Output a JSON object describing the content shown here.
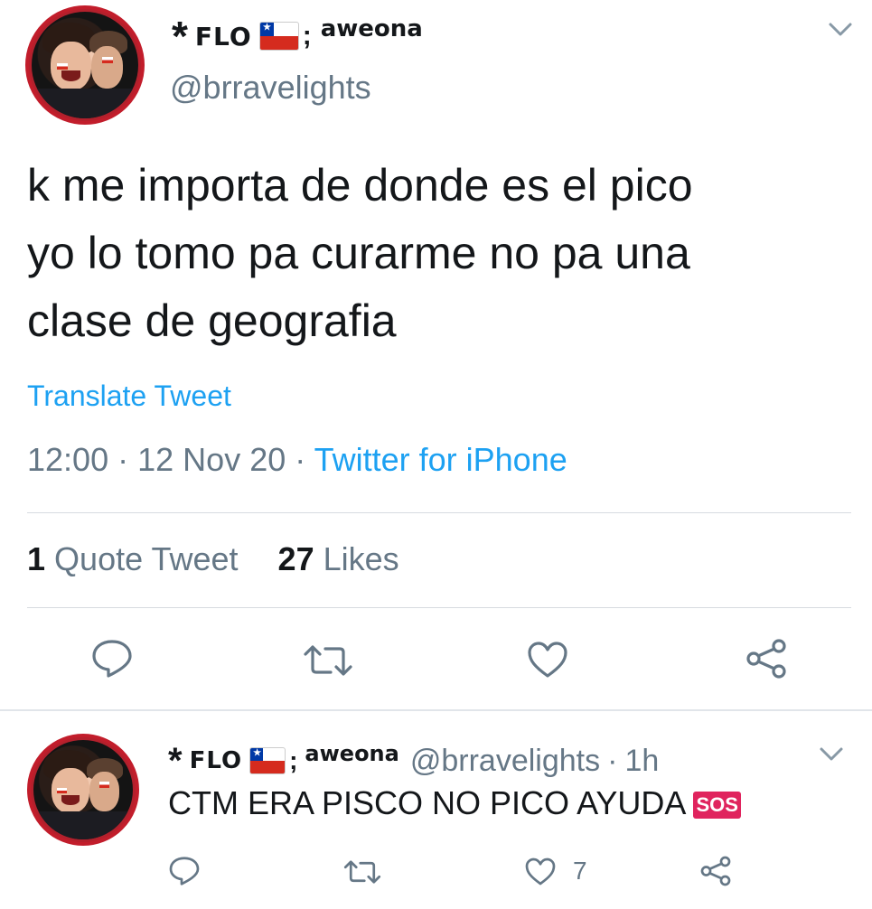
{
  "tweet": {
    "display_name": {
      "asterisk": "*",
      "name": "FLO",
      "separator": ";",
      "suffix": "aweona",
      "flag_icon": "chile-flag-icon"
    },
    "handle": "@brravelights",
    "text_lines": [
      "k me importa de donde es el pico",
      "yo lo tomo pa curarme no pa una",
      "clase de geografia"
    ],
    "translate_label": "Translate Tweet",
    "time": "12:00",
    "dot": "·",
    "date": "12 Nov 20",
    "source": "Twitter for iPhone",
    "quote_count": "1",
    "quote_label": "Quote Tweet",
    "likes_count": "27",
    "likes_label": "Likes",
    "actions": [
      "reply-icon",
      "retweet-icon",
      "like-icon",
      "share-icon"
    ]
  },
  "reply": {
    "display_name": {
      "asterisk": "*",
      "name": "FLO",
      "separator": ";",
      "suffix": "aweona"
    },
    "handle": "@brravelights",
    "dot": "·",
    "age": "1h",
    "text": "CTM ERA PISCO NO PICO AYUDA",
    "emoji_label": "SOS",
    "like_count": "7"
  },
  "colors": {
    "accent": "#1da1f2",
    "secondary_text": "#657786",
    "primary_text": "#14171a",
    "divider": "#e1e5ea"
  }
}
